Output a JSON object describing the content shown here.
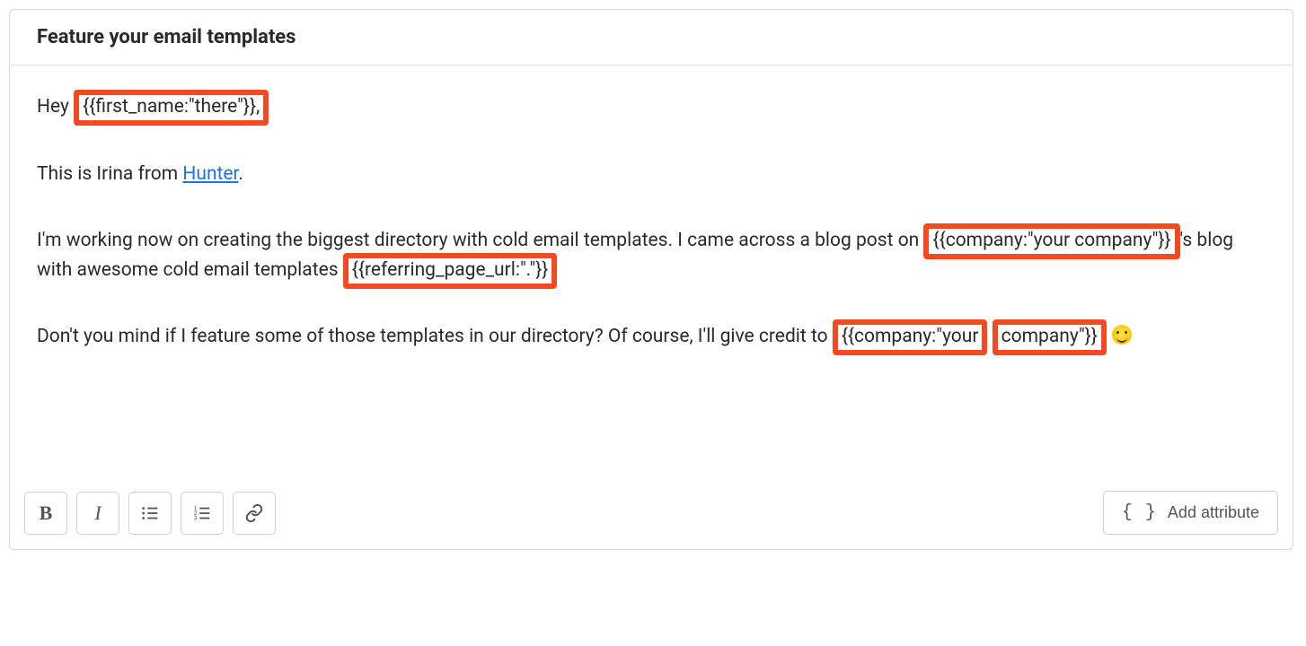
{
  "header": {
    "title": "Feature your email templates"
  },
  "body": {
    "greeting_prefix": "Hey ",
    "var_first_name": "{{first_name:\"there\"}},",
    "intro_prefix": "This is Irina from ",
    "intro_link": "Hunter",
    "intro_suffix": ".",
    "para2_a": "I'm working now on creating the biggest directory with cold email templates. I came across a blog post on ",
    "var_company1": "{{company:\"your company\"}}",
    "para2_b": "'s blog with awesome cold email templates ",
    "var_referring": "{{referring_page_url:\".\"}}",
    "para3_a": "Don't you mind if I feature some of those templates in our directory? Of course, I'll give credit to ",
    "var_company2a": "{{company:\"your",
    "var_company2b": "company\"}}"
  },
  "toolbar": {
    "bold": "B",
    "italic": "I",
    "add_attribute_braces": "{ }",
    "add_attribute_label": "Add attribute"
  }
}
